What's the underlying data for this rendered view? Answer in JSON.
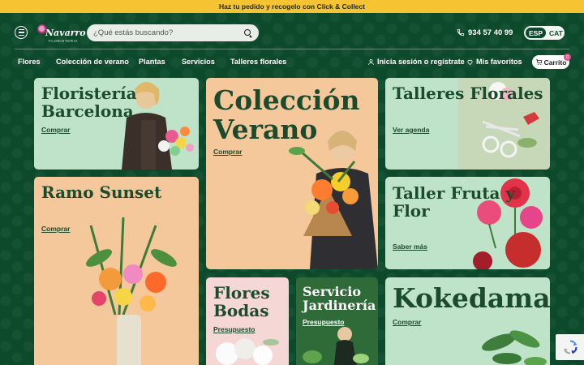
{
  "promo": {
    "text": "Haz tu pedido y recogelo con Click & Collect"
  },
  "header": {
    "logo_name": "Navarro",
    "logo_sub": "FLORISTERIA",
    "search_placeholder": "¿Qué estás buscando?",
    "phone": "934 57 40 99",
    "languages": [
      "ESP",
      "CAT"
    ],
    "active_language": "ESP"
  },
  "nav": {
    "items": [
      "Flores",
      "Colección de verano",
      "Plantas",
      "Servicios",
      "Talleres florales"
    ],
    "login": "Inicia sesión o regístrate",
    "favorites": "Mis favoritos",
    "cart": "Carrito",
    "cart_count": "0"
  },
  "cards": {
    "floristeria": {
      "title": "Floristería Barcelona",
      "link": "Comprar"
    },
    "coleccion": {
      "title": "Colección Verano",
      "link": "Comprar"
    },
    "talleres": {
      "title": "Talleres Florales",
      "link": "Ver agenda"
    },
    "ramo": {
      "title": "Ramo Sunset",
      "link": "Comprar"
    },
    "taller_fruta": {
      "title": "Taller Fruta y Flor",
      "link": "Saber más"
    },
    "flores_bodas": {
      "title": "Flores Bodas",
      "link": "Presupuesto"
    },
    "servicio": {
      "title": "Servicio Jardinería",
      "link": "Presupuesto"
    },
    "kokedamas": {
      "title": "Kokedamas",
      "link": "Comprar"
    }
  },
  "colors": {
    "background": "#0c4a2b",
    "promo": "#f6c333",
    "card_green": "#bfe3c8",
    "card_peach": "#f4c89a",
    "title_text": "#1c4a2c",
    "accent_pink": "#e1508f"
  },
  "icons": [
    "menu-icon",
    "search-icon",
    "phone-icon",
    "user-icon",
    "heart-icon",
    "cart-icon",
    "recaptcha-icon"
  ]
}
